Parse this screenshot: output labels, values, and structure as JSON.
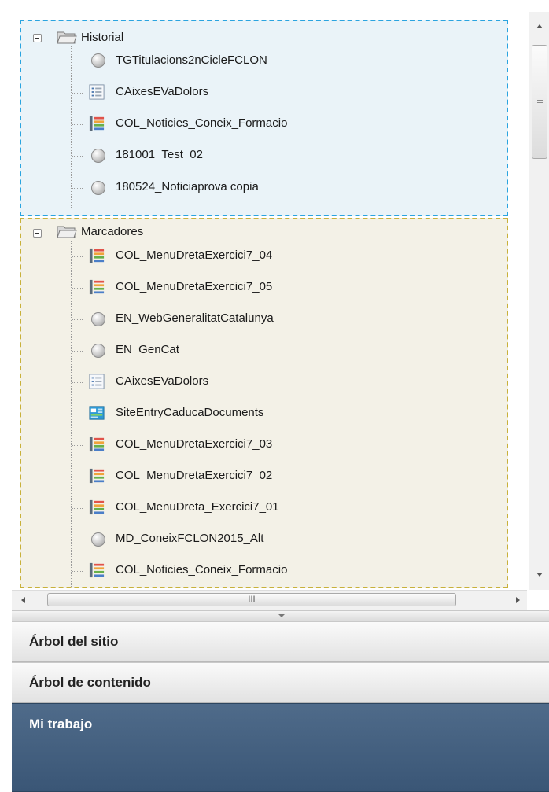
{
  "tree": {
    "historial": {
      "label": "Historial",
      "items": [
        {
          "label": "TGTitulacions2nCicleFCLON",
          "icon": "grey-orb-icon"
        },
        {
          "label": "CAixesEVaDolors",
          "icon": "list-document-icon"
        },
        {
          "label": "COL_Noticies_Coneix_Formacio",
          "icon": "colored-list-icon"
        },
        {
          "label": "181001_Test_02",
          "icon": "grey-orb-icon"
        },
        {
          "label": "180524_Noticiaprova copia",
          "icon": "grey-orb-icon"
        }
      ]
    },
    "marcadores": {
      "label": "Marcadores",
      "items": [
        {
          "label": "COL_MenuDretaExercici7_04",
          "icon": "colored-list-icon"
        },
        {
          "label": "COL_MenuDretaExercici7_05",
          "icon": "colored-list-icon"
        },
        {
          "label": "EN_WebGeneralitatCatalunya",
          "icon": "grey-orb-icon"
        },
        {
          "label": "EN_GenCat",
          "icon": "grey-orb-icon"
        },
        {
          "label": "CAixesEVaDolors",
          "icon": "list-document-icon"
        },
        {
          "label": "SiteEntryCaducaDocuments",
          "icon": "site-entry-icon"
        },
        {
          "label": "COL_MenuDretaExercici7_03",
          "icon": "colored-list-icon"
        },
        {
          "label": "COL_MenuDretaExercici7_02",
          "icon": "colored-list-icon"
        },
        {
          "label": "COL_MenuDreta_Exercici7_01",
          "icon": "colored-list-icon"
        },
        {
          "label": "MD_ConeixFCLON2015_Alt",
          "icon": "grey-orb-icon"
        },
        {
          "label": "COL_Noticies_Coneix_Formacio",
          "icon": "colored-list-icon"
        }
      ]
    }
  },
  "scroll": {
    "hthumb_text": "III"
  },
  "accordion": {
    "arbol_sitio": "Árbol del sitio",
    "arbol_contenido": "Árbol de contenido",
    "mi_trabajo": "Mi trabajo"
  },
  "colors": {
    "historial_border": "#2aa4e0",
    "marcadores_border": "#c8b13a",
    "active_tab": "#3f5b7b"
  }
}
